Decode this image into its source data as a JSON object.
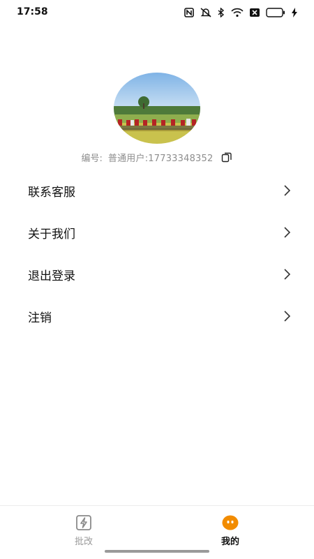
{
  "status_bar": {
    "time": "17:58",
    "icons": [
      "nfc-icon",
      "mute-icon",
      "bluetooth-icon",
      "wifi-icon",
      "sim-off-icon",
      "battery-icon",
      "charging-icon"
    ]
  },
  "profile": {
    "avatar_alt": "avatar photo",
    "id_label": "编号:",
    "id_value": "普通用户:17733348352",
    "copy_icon": "copy-icon"
  },
  "menu": {
    "items": [
      {
        "label": "联系客服"
      },
      {
        "label": "关于我们"
      },
      {
        "label": "退出登录"
      },
      {
        "label": "注销"
      }
    ]
  },
  "tabbar": {
    "tabs": [
      {
        "label": "批改",
        "icon": "lightning-icon",
        "active": false
      },
      {
        "label": "我的",
        "icon": "face-icon",
        "active": true
      }
    ]
  },
  "colors": {
    "accent": "#f28c00",
    "inactive": "#9a9a9a",
    "text": "#111111"
  }
}
